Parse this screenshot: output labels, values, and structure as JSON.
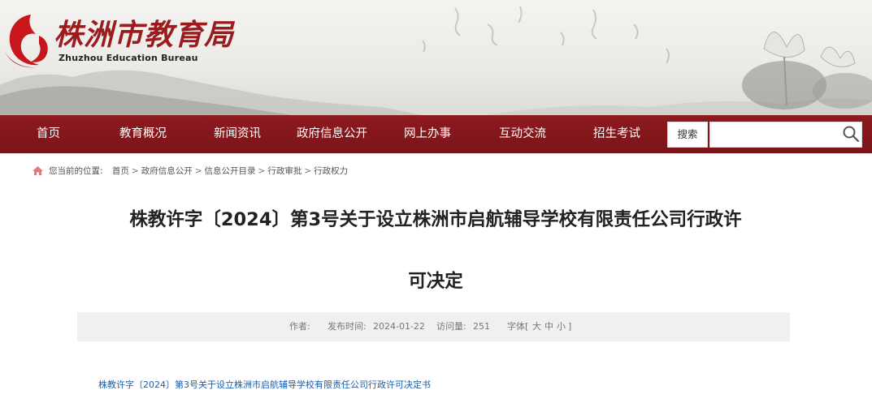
{
  "header": {
    "logo_cn": "株洲市教育局",
    "logo_en": "Zhuzhou Education Bureau",
    "brand_color": "#8e1a1f",
    "logo_icon": "zhuzhou-swirl-logo-icon"
  },
  "nav": {
    "items": [
      {
        "label": "首页"
      },
      {
        "label": "教育概况"
      },
      {
        "label": "新闻资讯"
      },
      {
        "label": "政府信息公开"
      },
      {
        "label": "网上办事"
      },
      {
        "label": "互动交流"
      },
      {
        "label": "招生考试"
      }
    ],
    "search_label": "搜索",
    "search_placeholder": "",
    "search_icon": "magnifier-icon"
  },
  "breadcrumb": {
    "prefix": "您当前的位置:",
    "items": [
      "首页",
      "政府信息公开",
      "信息公开目录",
      "行政审批",
      "行政权力"
    ],
    "separator": ">"
  },
  "article": {
    "title_line1": "株教许字〔2024〕第3号关于设立株洲市启航辅导学校有限责任公司行政许",
    "title_line2": "可决定",
    "meta": {
      "author_label": "作者:",
      "publish_label": "发布时间:",
      "publish_date": "2024-01-22",
      "views_label": "访问量:",
      "views": "251",
      "font_label": "字体[",
      "font_large": "大",
      "font_medium": "中",
      "font_small": "小",
      "font_close": "]"
    },
    "attachment_link": "株教许字〔2024〕第3号关于设立株洲市启航辅导学校有限责任公司行政许可决定书"
  }
}
